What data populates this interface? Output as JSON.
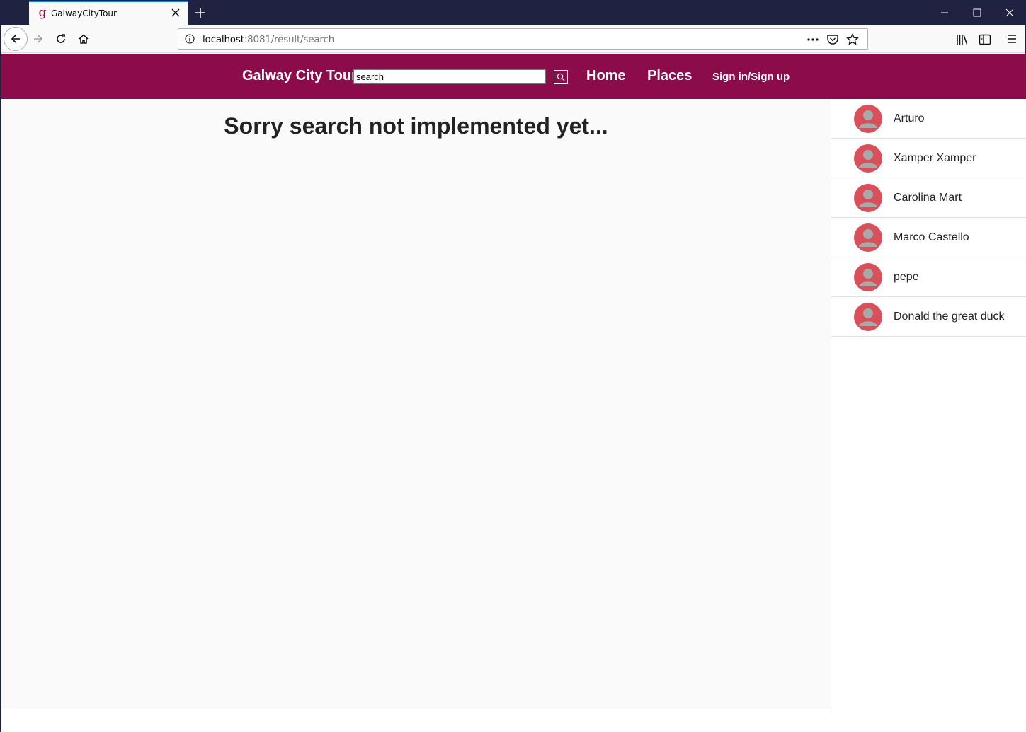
{
  "browser": {
    "tab_title": "GalwayCityTour",
    "tab_favicon": "g",
    "url_host": "localhost",
    "url_rest": ":8081/result/search"
  },
  "navbar": {
    "brand": "Galway City Tour",
    "search_value": "search",
    "home_label": "Home",
    "places_label": "Places",
    "signin_label": "Sign in/Sign up"
  },
  "main": {
    "heading": "Sorry search not implemented yet..."
  },
  "sidebar": {
    "users": [
      {
        "name": "Arturo"
      },
      {
        "name": "Xamper Xamper"
      },
      {
        "name": "Carolina Mart"
      },
      {
        "name": "Marco Castello"
      },
      {
        "name": "pepe"
      },
      {
        "name": "Donald the great duck"
      }
    ]
  },
  "colors": {
    "navbar": "#8c0c4b",
    "avatar": "#d9505a",
    "tabstrip": "#1f2240"
  }
}
